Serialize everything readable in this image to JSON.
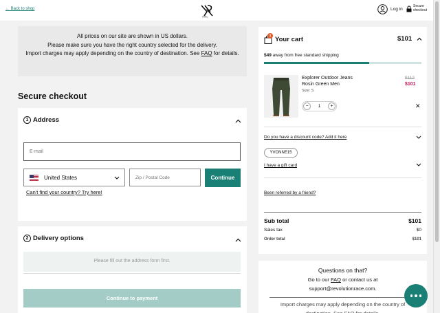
{
  "header": {
    "back_label": "← Back to shop",
    "login_label": "Log in",
    "secure_label": "Secure checkout"
  },
  "notice": {
    "line1": "All prices on our site are shown in US dollars.",
    "line2": "Please make sure you have the right country selected for the delivery.",
    "line3_prefix": "Import charges may apply depending on the country of destination. See ",
    "faq_label": "FAQ",
    "line3_suffix": " for details."
  },
  "checkout_title": "Secure checkout",
  "address": {
    "number": "1",
    "heading": "Address",
    "email_placeholder": "E-mail",
    "country_value": "United States",
    "zip_placeholder": "Zip / Postal Code",
    "continue_label": "Continue",
    "cant_find_label": "Can't find your country? Try here!"
  },
  "delivery": {
    "number": "2",
    "heading": "Delivery options",
    "note": "Please fill out the address form first.",
    "pay_label": "Continue to payment"
  },
  "cart": {
    "badge_count": "1",
    "heading": "Your cart",
    "total_top": "$101",
    "ship_amount": "$49",
    "ship_text": " away from free standard shipping",
    "shipping_progress": 0.67,
    "product": {
      "name_line1": "Explorer Outdoor Jeans",
      "name_line2": "Rosin Green Men",
      "size": "Size: S",
      "price_old": "$112",
      "price_new": "$101",
      "quantity": "1",
      "minus": "−",
      "plus": "+",
      "remove": "✕"
    },
    "discount_label": "Do you have a discount code? Add it here",
    "code_chip": "YVONNE15",
    "gift_label": "I have a gift card",
    "referred_label": "Been referred by a friend?",
    "summary": {
      "subtotal_label": "Sub total",
      "subtotal_value": "$101",
      "tax_label": "Sales tax",
      "tax_value": "$0",
      "order_label": "Order total",
      "order_value": "$101"
    }
  },
  "help": {
    "title": "Questions on that?",
    "line1_prefix": "Go to our ",
    "faq_label": "FAQ",
    "line1_suffix": " or contact us at",
    "email": "support@revolutionrace.com.",
    "import_text": "Import charges may apply depending on the country of destination. See FAQ for details."
  },
  "colors": {
    "accent": "#1a7f74",
    "sale": "#c0135a",
    "disabled_button": "#a3ccc6"
  }
}
